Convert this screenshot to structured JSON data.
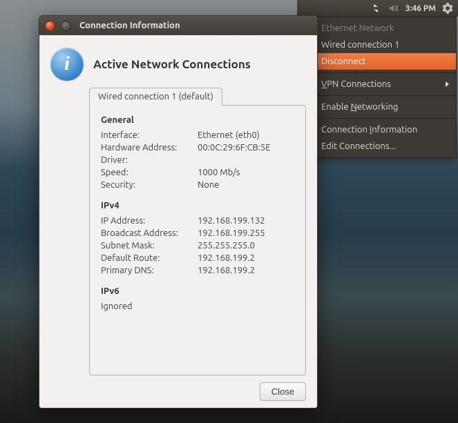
{
  "panel": {
    "clock": "3:46 PM"
  },
  "menu": {
    "header": "Ethernet Network",
    "wired": "Wired connection 1",
    "disconnect": "Disconnect",
    "vpn": "VPN Connections",
    "enable_net": "Enable Networking",
    "conn_info": "Connection Information",
    "edit_conn": "Edit Connections..."
  },
  "dialog": {
    "title": "Connection Information",
    "heading": "Active Network Connections",
    "tab": "Wired connection 1 (default)",
    "close": "Close",
    "sections": {
      "general": {
        "title": "General",
        "rows": [
          {
            "k": "Interface:",
            "v": "Ethernet (eth0)"
          },
          {
            "k": "Hardware Address:",
            "v": "00:0C:29:6F:CB:5E"
          },
          {
            "k": "Driver:",
            "v": ""
          },
          {
            "k": "Speed:",
            "v": "1000 Mb/s"
          },
          {
            "k": "Security:",
            "v": "None"
          }
        ]
      },
      "ipv4": {
        "title": "IPv4",
        "rows": [
          {
            "k": "IP Address:",
            "v": "192.168.199.132"
          },
          {
            "k": "Broadcast Address:",
            "v": "192.168.199.255"
          },
          {
            "k": "Subnet Mask:",
            "v": "255.255.255.0"
          },
          {
            "k": "Default Route:",
            "v": "192.168.199.2"
          },
          {
            "k": "Primary DNS:",
            "v": "192.168.199.2"
          }
        ]
      },
      "ipv6": {
        "title": "IPv6",
        "rows": [
          {
            "k": "Ignored",
            "v": ""
          }
        ]
      }
    }
  }
}
